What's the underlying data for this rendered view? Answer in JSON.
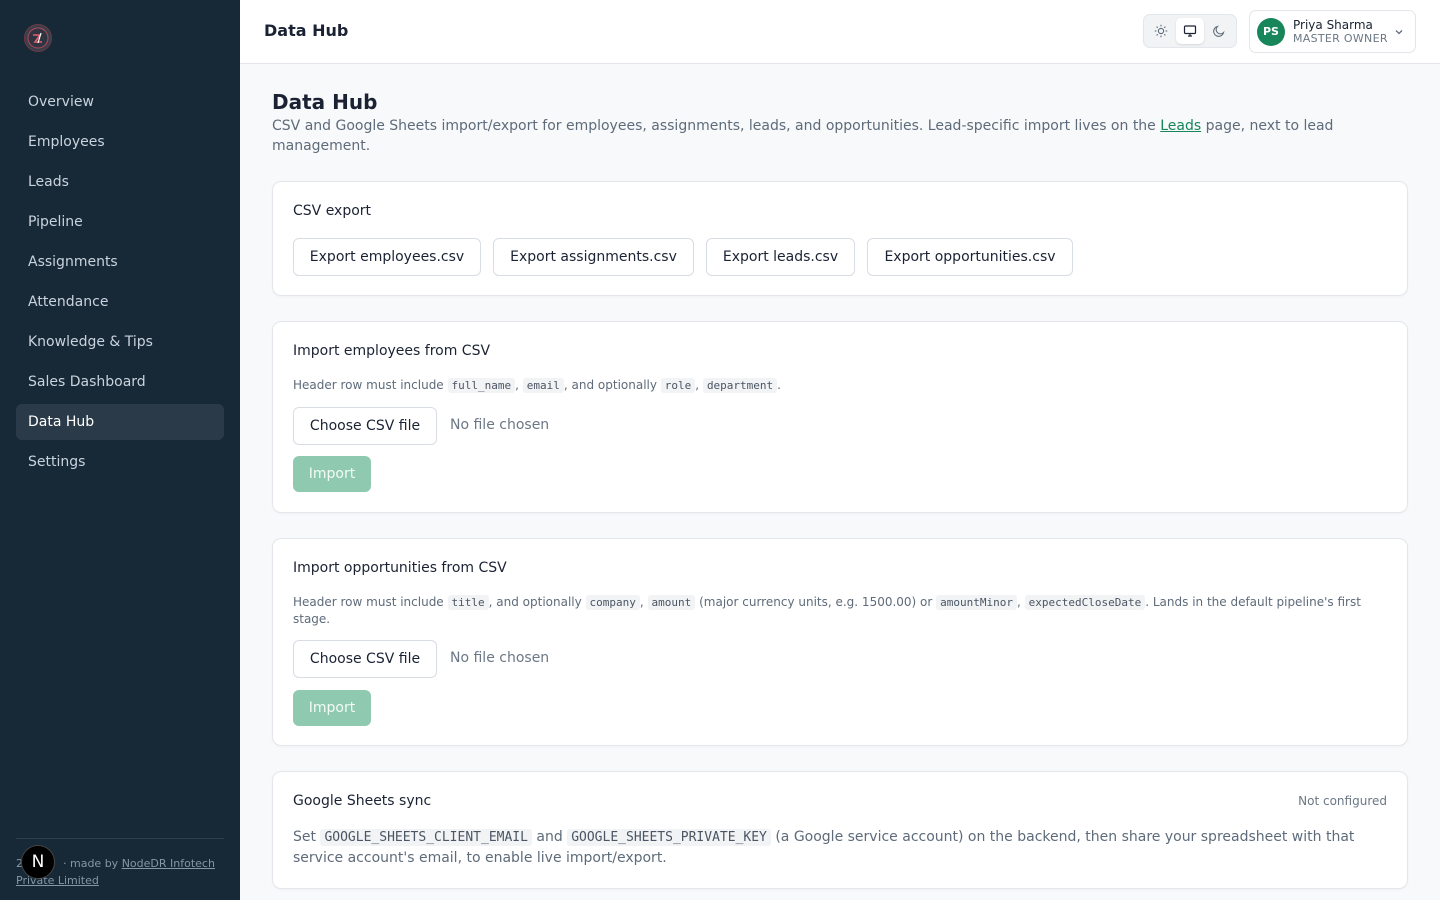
{
  "sidebar": {
    "logo_alt": "TPC",
    "items": [
      {
        "label": "Overview"
      },
      {
        "label": "Employees"
      },
      {
        "label": "Leads"
      },
      {
        "label": "Pipeline"
      },
      {
        "label": "Assignments"
      },
      {
        "label": "Attendance"
      },
      {
        "label": "Knowledge & Tips"
      },
      {
        "label": "Sales Dashboard"
      },
      {
        "label": "Data Hub",
        "active": true
      },
      {
        "label": "Settings"
      }
    ],
    "footer": {
      "prefix": "2",
      "made_by": "· made by ",
      "company": "NodeDR Infotech Private Limited"
    },
    "n_badge": "N"
  },
  "header": {
    "title": "Data Hub",
    "theme": {
      "options": [
        "light-icon",
        "system-icon",
        "dark-icon"
      ],
      "selected": "system-icon"
    },
    "user": {
      "initials": "PS",
      "name": "Priya Sharma",
      "role": "MASTER OWNER"
    }
  },
  "page": {
    "title": "Data Hub",
    "desc_before": "CSV and Google Sheets import/export for employees, assignments, leads, and opportunities. Lead-specific import lives on the ",
    "desc_link": "Leads",
    "desc_after": " page, next to lead management."
  },
  "csv_export": {
    "title": "CSV export",
    "buttons": [
      "Export employees.csv",
      "Export assignments.csv",
      "Export leads.csv",
      "Export opportunities.csv"
    ]
  },
  "import_employees": {
    "title": "Import employees from CSV",
    "help": {
      "p1": "Header row must include ",
      "c1": "full_name",
      "p2": ", ",
      "c2": "email",
      "p3": ", and optionally ",
      "c3": "role",
      "p4": ", ",
      "c4": "department",
      "p5": "."
    },
    "choose_label": "Choose CSV file",
    "no_file": "No file chosen",
    "import_label": "Import"
  },
  "import_opportunities": {
    "title": "Import opportunities from CSV",
    "help": {
      "p1": "Header row must include ",
      "c1": "title",
      "p2": ", and optionally ",
      "c2": "company",
      "p3": ", ",
      "c3": "amount",
      "p4": " (major currency units, e.g. 1500.00) or ",
      "c4": "amountMinor",
      "p5": ", ",
      "c5": "expectedCloseDate",
      "p6": ". Lands in the default pipeline's first stage."
    },
    "choose_label": "Choose CSV file",
    "no_file": "No file chosen",
    "import_label": "Import"
  },
  "google_sheets": {
    "title": "Google Sheets sync",
    "status": "Not configured",
    "t1": "Set ",
    "c1": "GOOGLE_SHEETS_CLIENT_EMAIL",
    "t2": " and ",
    "c2": "GOOGLE_SHEETS_PRIVATE_KEY",
    "t3": " (a Google service account) on the backend, then share your spreadsheet with that service account's email, to enable live import/export."
  },
  "colors": {
    "sidebar": "#172836",
    "accent": "#17865b",
    "import_disabled": "#8fcab0"
  }
}
